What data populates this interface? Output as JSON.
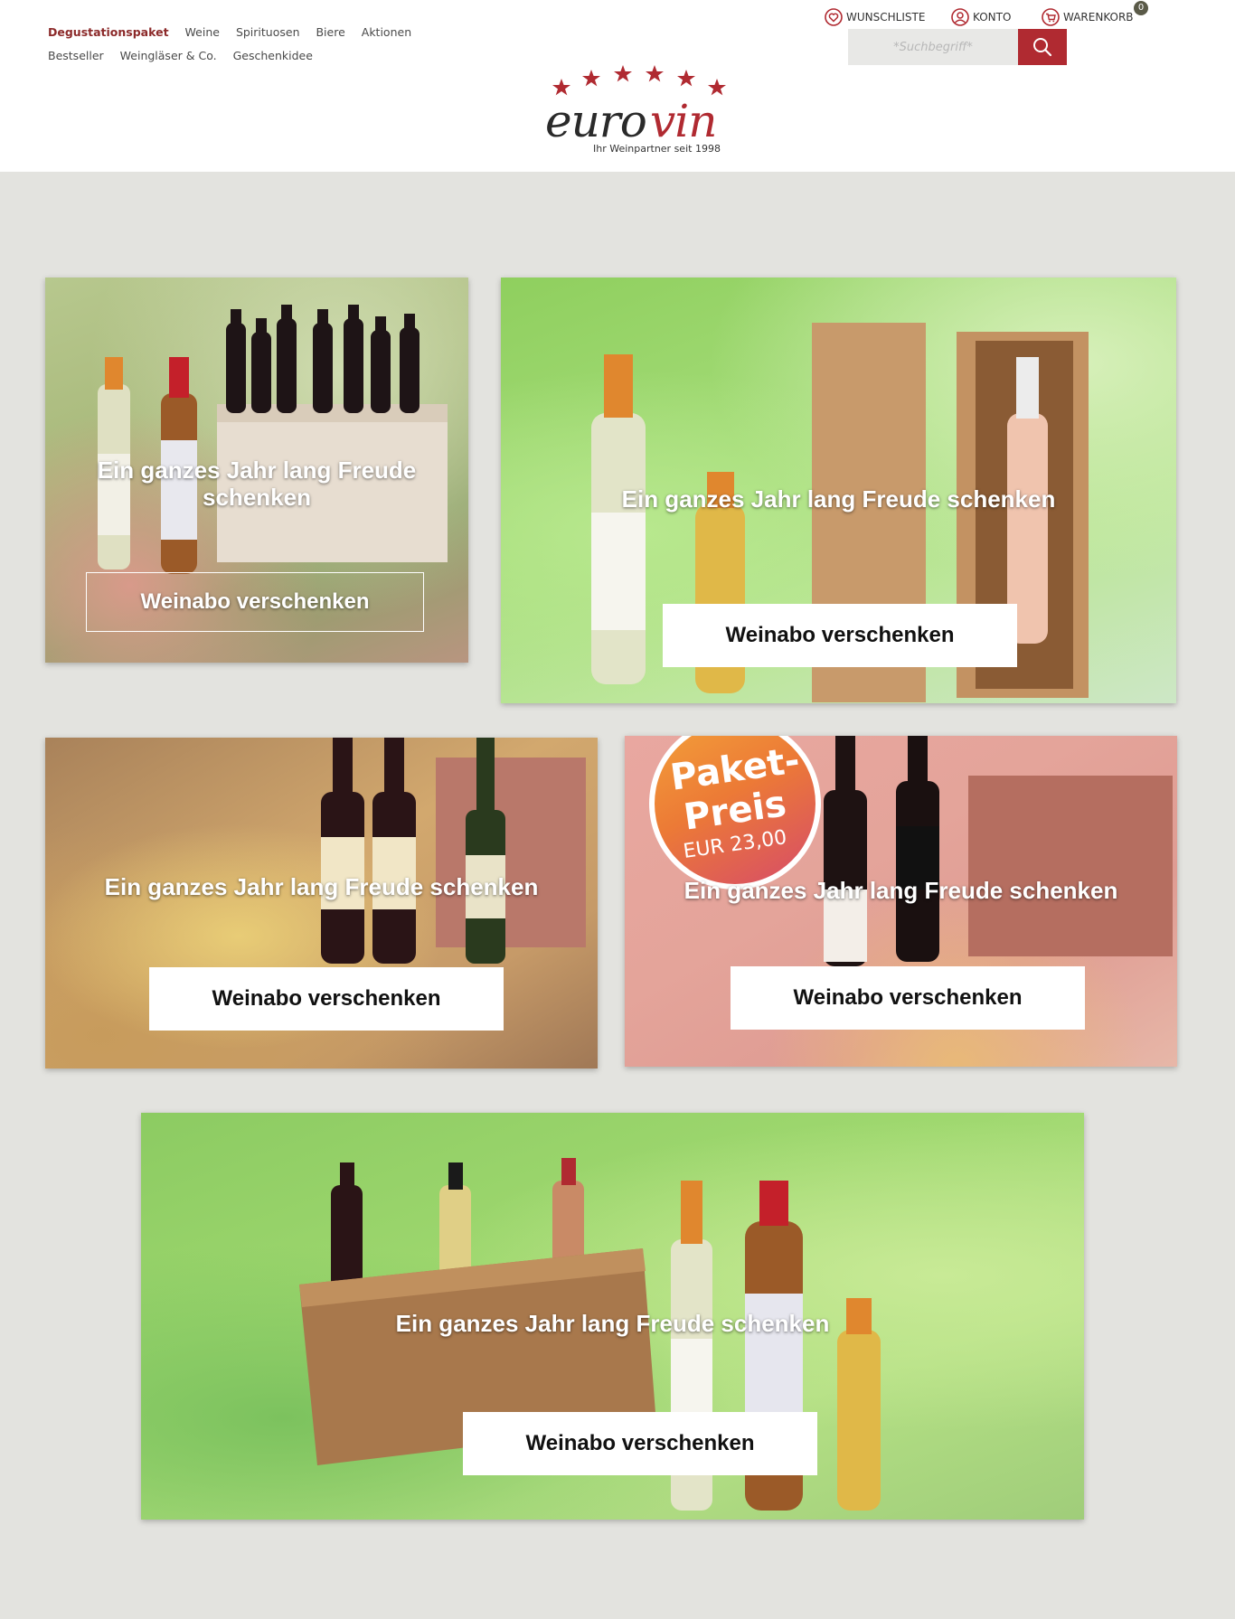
{
  "nav": {
    "row1": [
      "Degustationspaket",
      "Weine",
      "Spirituosen",
      "Biere",
      "Aktionen"
    ],
    "row2": [
      "Bestseller",
      "Weingläser & Co.",
      "Geschenkidee"
    ]
  },
  "topbar": {
    "wishlist": "WUNSCHLISTE",
    "account": "KONTO",
    "cart": "WARENKORB",
    "cart_count": "0"
  },
  "search": {
    "placeholder": "*Suchbegriff*",
    "value": ""
  },
  "logo": {
    "brand": "eurovin",
    "tagline": "Ihr Weinpartner seit 1998"
  },
  "colors": {
    "brand_red": "#b02a31",
    "nav_active": "#8c2a2a",
    "page_bg": "#e3e3df"
  },
  "promo": {
    "badge": {
      "line1": "Paket-",
      "line2": "Preis",
      "price": "EUR 23,00"
    },
    "cards": [
      {
        "title": "Ein ganzes Jahr lang Freude schenken",
        "button": "Weinabo verschenken"
      },
      {
        "title": "Ein ganzes Jahr lang Freude schenken",
        "button": "Weinabo verschenken"
      },
      {
        "title": "Ein ganzes Jahr lang Freude schenken",
        "button": "Weinabo verschenken"
      },
      {
        "title": "Ein ganzes Jahr lang Freude schenken",
        "button": "Weinabo verschenken"
      },
      {
        "title": "Ein ganzes Jahr lang Freude schenken",
        "button": "Weinabo verschenken"
      }
    ]
  }
}
